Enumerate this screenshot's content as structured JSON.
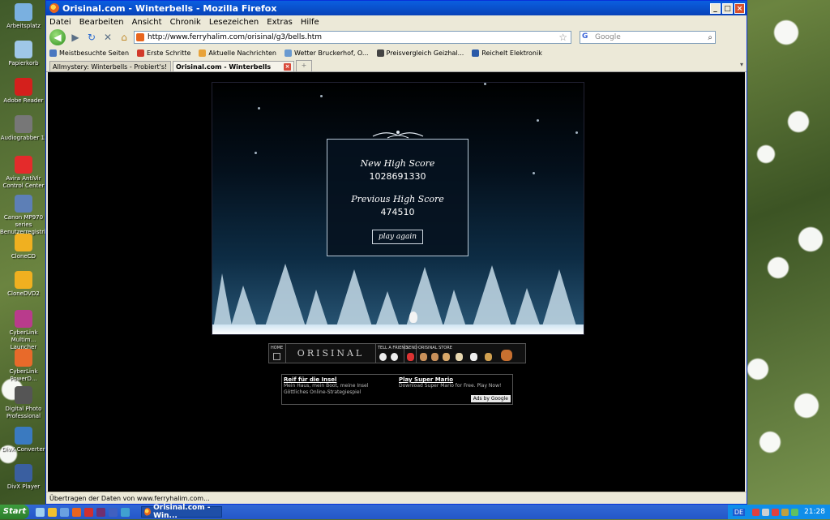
{
  "desktop": {
    "icons": [
      {
        "label": "Arbeitsplatz",
        "color": "#7ab0e0"
      },
      {
        "label": "Papierkorb",
        "color": "#9fc7e8"
      },
      {
        "label": "Adobe Reader",
        "color": "#d4201c"
      },
      {
        "label": "Audiograbber 1.",
        "color": "#777777"
      },
      {
        "label": "Avira AntiVir Control Center",
        "color": "#e42b2b"
      },
      {
        "label": "Canon MP970 series Benutzerregistri...",
        "color": "#5d7fb6"
      },
      {
        "label": "CloneCD",
        "color": "#f0b020"
      },
      {
        "label": "CloneDVD2",
        "color": "#f0b020"
      },
      {
        "label": "CyberLink Multim... Launcher",
        "color": "#b93b8c"
      },
      {
        "label": "CyberLink PowerD...",
        "color": "#e86a2a"
      },
      {
        "label": "Digital Photo Professional",
        "color": "#555555"
      },
      {
        "label": "DivX Converter",
        "color": "#3a7ac0"
      },
      {
        "label": "DivX Player",
        "color": "#3a5fa0"
      }
    ]
  },
  "window": {
    "title": "Orisinal.com - Winterbells - Mozilla Firefox",
    "controls": {
      "minimize": "_",
      "maximize": "□",
      "close": "×"
    }
  },
  "menu": {
    "items": [
      "Datei",
      "Bearbeiten",
      "Ansicht",
      "Chronik",
      "Lesezeichen",
      "Extras",
      "Hilfe"
    ]
  },
  "nav": {
    "back": "◀",
    "forward": "▶",
    "reload": "↻",
    "stop": "✕",
    "home": "⌂",
    "url": "http://www.ferryhalim.com/orisinal/g3/bells.htm",
    "search_engine": "G",
    "search_placeholder": "Google"
  },
  "bookmarks": [
    {
      "label": "Meistbesuchte Seiten",
      "color": "#4a78c0"
    },
    {
      "label": "Erste Schritte",
      "color": "#d23a2a"
    },
    {
      "label": "Aktuelle Nachrichten",
      "color": "#e8a33a"
    },
    {
      "label": "Wetter Bruckerhof, O...",
      "color": "#6a9ad0"
    },
    {
      "label": "Preisvergleich Geizhal...",
      "color": "#444444"
    },
    {
      "label": "Reichelt Elektronik",
      "color": "#2a5aa8"
    }
  ],
  "tabs": [
    {
      "label": "Allmystery: Winterbells - Probiert's!!! (...",
      "active": false
    },
    {
      "label": "Orisinal.com - Winterbells",
      "active": true
    }
  ],
  "game": {
    "new_high_score_label": "New High Score",
    "new_high_score": "1028691330",
    "previous_high_score_label": "Previous High Score",
    "previous_high_score": "474510",
    "play_again": "play again"
  },
  "orisinal_bar": {
    "home_label": "HOME",
    "logo": "ORISINAL",
    "tell_friend_label": "TELL A FRIEND",
    "send_label": "SEND",
    "store_label": "ORISINAL STORE"
  },
  "ads": [
    {
      "title": "Reif für die Insel",
      "desc": "Mein Haus, mein Boot, meine Insel Göttliches Online-Strategiespiel"
    },
    {
      "title": "Play Super Mario",
      "desc": "Download Super Mario for Free. Play Now!"
    }
  ],
  "ads_by": "Ads by Google",
  "status": "Übertragen der Daten von www.ferryhalim.com...",
  "taskbar": {
    "start": "Start",
    "task": "Orisinal.com - Win...",
    "language": "DE",
    "clock": "21:28"
  }
}
